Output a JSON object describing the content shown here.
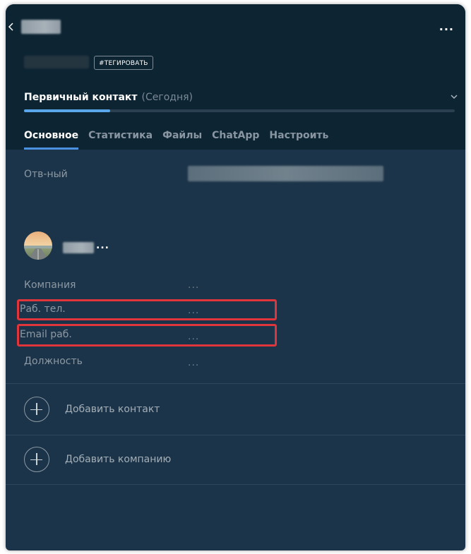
{
  "header": {
    "tag_button_label": "#ТЕГИРОВАТЬ",
    "more_label": "..."
  },
  "status": {
    "name": "Первичный контакт",
    "date": "(Сегодня)",
    "progress_fraction": 0.2
  },
  "tabs": [
    {
      "label": "Основное",
      "active": true
    },
    {
      "label": "Статистика",
      "active": false
    },
    {
      "label": "Файлы",
      "active": false
    },
    {
      "label": "ChatApp",
      "active": false
    },
    {
      "label": "Настроить",
      "active": false
    }
  ],
  "responsible": {
    "label": "Отв-ный"
  },
  "contact": {
    "more_label": "...",
    "fields": [
      {
        "label": "Компания",
        "value": "..."
      },
      {
        "label": "Раб. тел.",
        "value": "..."
      },
      {
        "label": "Email раб.",
        "value": "..."
      },
      {
        "label": "Должность",
        "value": "..."
      }
    ]
  },
  "actions": {
    "add_contact": "Добавить контакт",
    "add_company": "Добавить компанию"
  },
  "colors": {
    "card_bg": "#1c3449",
    "header_bg": "#0d2433",
    "accent": "#4a92e0",
    "highlight": "#e0353a"
  }
}
